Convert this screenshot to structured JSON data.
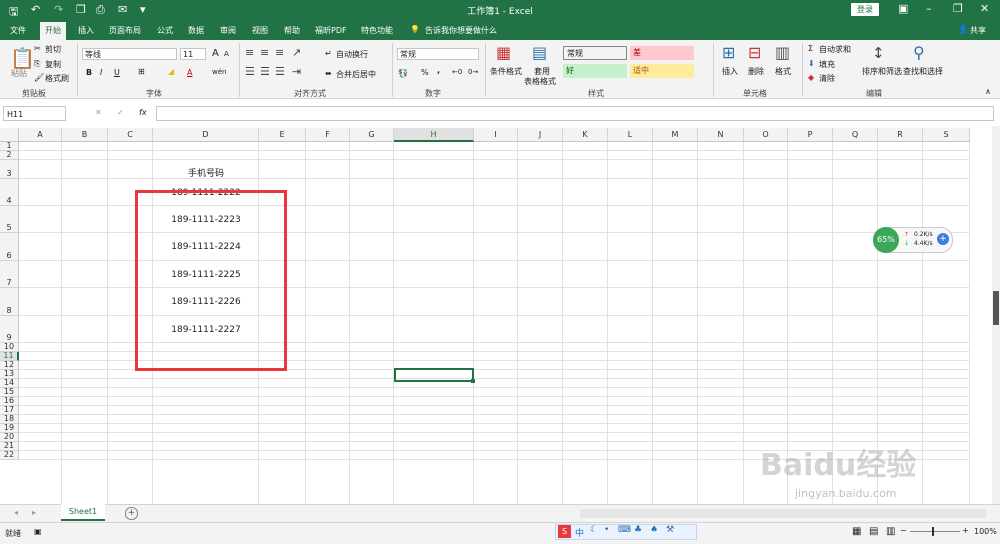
{
  "window": {
    "title": "工作簿1  -  Excel",
    "login_label": "登录",
    "share_label": "共享"
  },
  "tabs": [
    {
      "label": "文件"
    },
    {
      "label": "开始"
    },
    {
      "label": "插入"
    },
    {
      "label": "页面布局"
    },
    {
      "label": "公式"
    },
    {
      "label": "数据"
    },
    {
      "label": "审阅"
    },
    {
      "label": "视图"
    },
    {
      "label": "帮助"
    },
    {
      "label": "福昕PDF"
    },
    {
      "label": "特色功能"
    }
  ],
  "tell_me": "告诉我你想要做什么",
  "ribbon": {
    "clipboard": {
      "paste": "粘贴",
      "cut": "剪切",
      "copy": "复制",
      "format_painter": "格式刷",
      "group": "剪贴板"
    },
    "font": {
      "name": "等线",
      "size": "11",
      "group": "字体",
      "bold": "B",
      "italic": "I",
      "underline": "U",
      "grow": "A",
      "shrink": "A",
      "color_glyph": "A",
      "phonetic": "wén"
    },
    "alignment": {
      "wrap": "自动换行",
      "merge": "合并后居中",
      "group": "对齐方式"
    },
    "number": {
      "format": "常规",
      "percent": "%",
      "comma": ",",
      "group": "数字"
    },
    "styles": {
      "conditional": "条件格式",
      "table": "套用",
      "table2": "表格格式",
      "group": "样式",
      "cells": [
        {
          "label": "常规",
          "bg": "#ffffff",
          "fg": "#222222"
        },
        {
          "label": "差",
          "bg": "#ffc7ce",
          "fg": "#9c0006"
        },
        {
          "label": "好",
          "bg": "#c6efce",
          "fg": "#006100"
        },
        {
          "label": "适中",
          "bg": "#ffeb9c",
          "fg": "#9c5700"
        }
      ]
    },
    "cells": {
      "insert": "插入",
      "delete": "删除",
      "format": "格式",
      "group": "单元格"
    },
    "editing": {
      "autosum": "自动求和",
      "fill": "填充",
      "clear": "清除",
      "sort": "排序和筛选",
      "find": "查找和选择",
      "group": "编辑"
    }
  },
  "formula_bar": {
    "name_box": "H11",
    "fx": "fx",
    "value": ""
  },
  "grid": {
    "columns": [
      "A",
      "B",
      "C",
      "D",
      "E",
      "F",
      "G",
      "H",
      "I",
      "J",
      "K",
      "L",
      "M",
      "N",
      "O",
      "P",
      "Q",
      "R",
      "S"
    ],
    "rows": [
      "1",
      "2",
      "3",
      "4",
      "5",
      "6",
      "7",
      "8",
      "9",
      "10",
      "11",
      "12",
      "13",
      "14",
      "15",
      "16",
      "17",
      "18",
      "19",
      "20",
      "21",
      "22"
    ],
    "selected_cell": "H11",
    "header_cell": "手机号码",
    "phone_numbers": [
      "189-1111-2222",
      "189-1111-2223",
      "189-1111-2224",
      "189-1111-2225",
      "189-1111-2226",
      "189-1111-2227"
    ],
    "highlight_color": "#e8383d"
  },
  "speed_widget": {
    "percent": "65%",
    "up": "0.2K/s",
    "down": "4.4K/s"
  },
  "sheet_tabs": [
    {
      "label": "Sheet1"
    }
  ],
  "status": {
    "ready": "就绪",
    "zoom": "100%"
  },
  "ime_toolbar": {
    "mode": "中"
  },
  "watermark": "Baidu经验",
  "watermark_url": "jingyan.baidu.com",
  "accent_color": "#217346"
}
